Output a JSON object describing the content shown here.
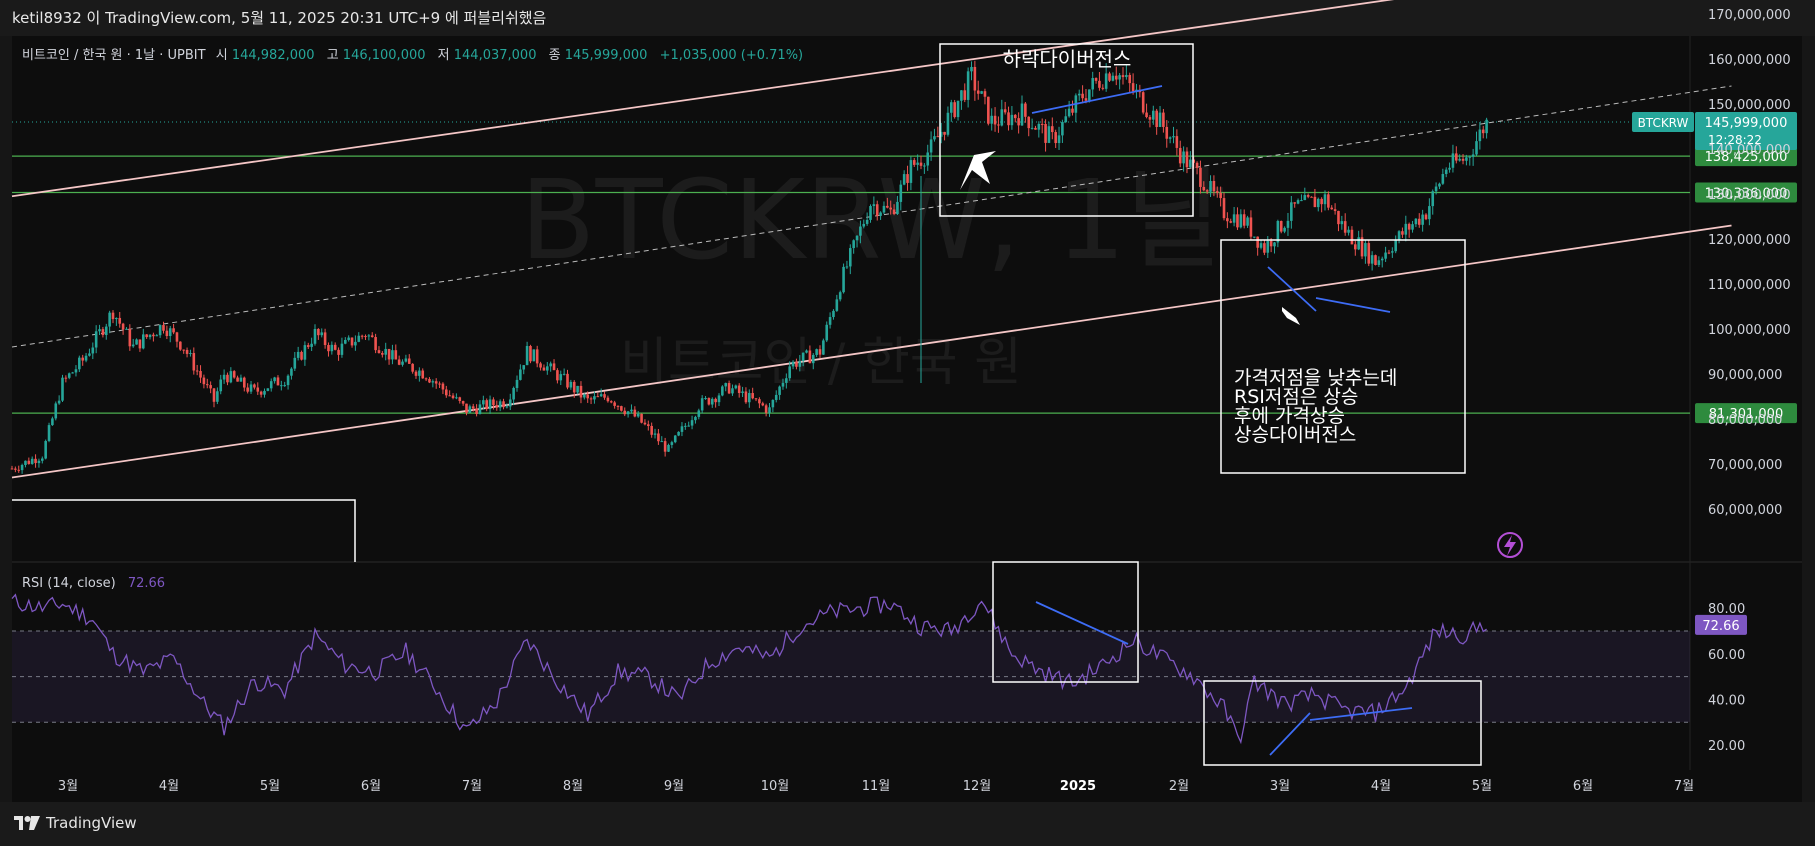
{
  "header": {
    "publish_line": "ketil8932 이 TradingView.com, 5월 11, 2025 20:31 UTC+9 에 퍼블리쉬했음"
  },
  "footer": {
    "brand": "TradingView"
  },
  "colors": {
    "up": "#26a69a",
    "down": "#ef5350",
    "channel": "#f4c6c6",
    "level": "#4caf50",
    "rsi": "#7e57c2",
    "annotation": "#ffffff",
    "divergence": "#3d6cf5"
  },
  "icons": {
    "flash": "lightning-icon",
    "logo": "tradingview-logo-icon"
  },
  "chart_data": [
    {
      "type": "candlestick",
      "symbol_line": {
        "name": "비트코인 / 한국 원 · 1날 · UPBIT",
        "open_label": "시",
        "open": "144,982,000",
        "high_label": "고",
        "high": "146,100,000",
        "low_label": "저",
        "low": "144,037,000",
        "close_label": "종",
        "close": "145,999,000",
        "change": "+1,035,000 (+0.71%)"
      },
      "watermark": {
        "ticker": "BTCKRW, 1날",
        "name": "비트코인 / 한국 원"
      },
      "ylim": [
        55000000,
        175000000
      ],
      "y_ticks": [
        "170,000,000",
        "160,000,000",
        "150,000,000",
        "140,000,000",
        "130,000,000",
        "120,000,000",
        "110,000,000",
        "100,000,000",
        "90,000,000",
        "80,000,000",
        "70,000,000",
        "60,000,000"
      ],
      "y_tick_values": [
        170000000,
        160000000,
        150000000,
        140000000,
        130000000,
        120000000,
        110000000,
        100000000,
        90000000,
        80000000,
        70000000,
        60000000
      ],
      "x_ticks": [
        "3월",
        "4월",
        "5월",
        "6월",
        "7월",
        "8월",
        "9월",
        "10월",
        "11월",
        "12월",
        "2025",
        "2월",
        "3월",
        "4월",
        "5월",
        "6월",
        "7월"
      ],
      "x_tick_months": [
        0,
        1,
        2,
        3,
        4,
        5,
        6,
        7,
        8,
        9,
        10,
        11,
        12,
        13,
        14,
        15,
        16
      ],
      "price_path_months": [
        0,
        0.3,
        0.5,
        0.7,
        1.0,
        1.2,
        1.5,
        1.7,
        2.0,
        2.1,
        2.4,
        2.7,
        3.0,
        3.2,
        3.5,
        3.8,
        4.1,
        4.5,
        4.9,
        5.1,
        5.5,
        5.7,
        5.9,
        6.2,
        6.5,
        6.8,
        7.1,
        7.5,
        7.7,
        8.0,
        8.2,
        8.5,
        8.7,
        8.9,
        9.1,
        9.3,
        9.5,
        9.7,
        10.0,
        10.3,
        10.6,
        10.9,
        11.1,
        11.4,
        11.6,
        11.8,
        12.0,
        12.2,
        12.4,
        12.7,
        13.0,
        13.2,
        13.5,
        13.8,
        14.0,
        14.2,
        14.4,
        14.6
      ],
      "price_path_values": [
        69000000,
        72000000,
        88000000,
        93000000,
        104000000,
        96000000,
        101000000,
        96000000,
        84000000,
        90000000,
        86000000,
        89000000,
        99000000,
        95000000,
        99000000,
        93000000,
        90000000,
        82000000,
        84000000,
        95000000,
        88000000,
        84000000,
        85000000,
        80000000,
        73000000,
        83000000,
        87000000,
        82000000,
        92000000,
        95000000,
        110000000,
        128000000,
        126000000,
        136000000,
        140000000,
        148000000,
        156000000,
        146000000,
        148000000,
        142000000,
        152000000,
        158000000,
        153000000,
        145000000,
        138000000,
        133000000,
        126000000,
        124000000,
        118000000,
        127000000,
        129000000,
        122000000,
        115000000,
        122000000,
        126000000,
        136000000,
        138000000,
        146000000
      ],
      "horizontal_levels": [
        {
          "value": 138425000,
          "label": "138,425,000"
        },
        {
          "value": 130336000,
          "label": "130,336,000"
        },
        {
          "value": 81301000,
          "label": "81,301,000"
        }
      ],
      "last_price": {
        "ticker": "BTCKRW",
        "value": 145999000,
        "label": "145,999,000",
        "countdown": "12:28:22"
      },
      "channel_lines": {
        "upper": [
          [
            0,
            129500000
          ],
          [
            14.0,
            176000000
          ]
        ],
        "lower": [
          [
            0,
            67000000
          ],
          [
            16.5,
            123000000
          ]
        ],
        "middle": [
          [
            0,
            96000000
          ],
          [
            16.5,
            154000000
          ]
        ]
      },
      "annotations": [
        {
          "id": "bearish-div",
          "text": "하락다이버전스"
        },
        {
          "id": "bullish-div",
          "lines": [
            "가격저점을 낮추는데",
            "RSI저점은 상승",
            "후에 가격상승",
            "상승다이버전스"
          ]
        }
      ]
    },
    {
      "type": "line",
      "indicator": "RSI",
      "title": "RSI (14, close)",
      "last_value": "72.66",
      "ylim": [
        10,
        90
      ],
      "y_ticks": [
        "80.00",
        "60.00",
        "40.00",
        "20.00"
      ],
      "y_tick_values": [
        80,
        60,
        40,
        20
      ],
      "bands": {
        "upper": 70,
        "middle": 50,
        "lower": 30
      },
      "x_months": [
        0,
        0.3,
        0.5,
        0.8,
        1.0,
        1.3,
        1.6,
        1.9,
        2.1,
        2.4,
        2.7,
        3.0,
        3.3,
        3.6,
        3.9,
        4.2,
        4.5,
        4.8,
        5.1,
        5.4,
        5.7,
        6.0,
        6.3,
        6.6,
        6.9,
        7.2,
        7.5,
        7.8,
        8.1,
        8.4,
        8.7,
        9.0,
        9.3,
        9.6,
        9.9,
        10.2,
        10.5,
        10.8,
        11.1,
        11.4,
        11.7,
        12.0,
        12.15,
        12.3,
        12.6,
        12.9,
        13.2,
        13.5,
        13.8,
        14.1,
        14.4,
        14.6
      ],
      "values": [
        83,
        80,
        82,
        75,
        60,
        52,
        58,
        38,
        28,
        48,
        44,
        68,
        55,
        52,
        61,
        45,
        26,
        39,
        66,
        48,
        33,
        52,
        50,
        40,
        56,
        63,
        58,
        72,
        78,
        80,
        82,
        72,
        70,
        84,
        60,
        52,
        47,
        55,
        66,
        58,
        50,
        36,
        22,
        48,
        38,
        42,
        35,
        34,
        45,
        70,
        68,
        74
      ]
    }
  ]
}
